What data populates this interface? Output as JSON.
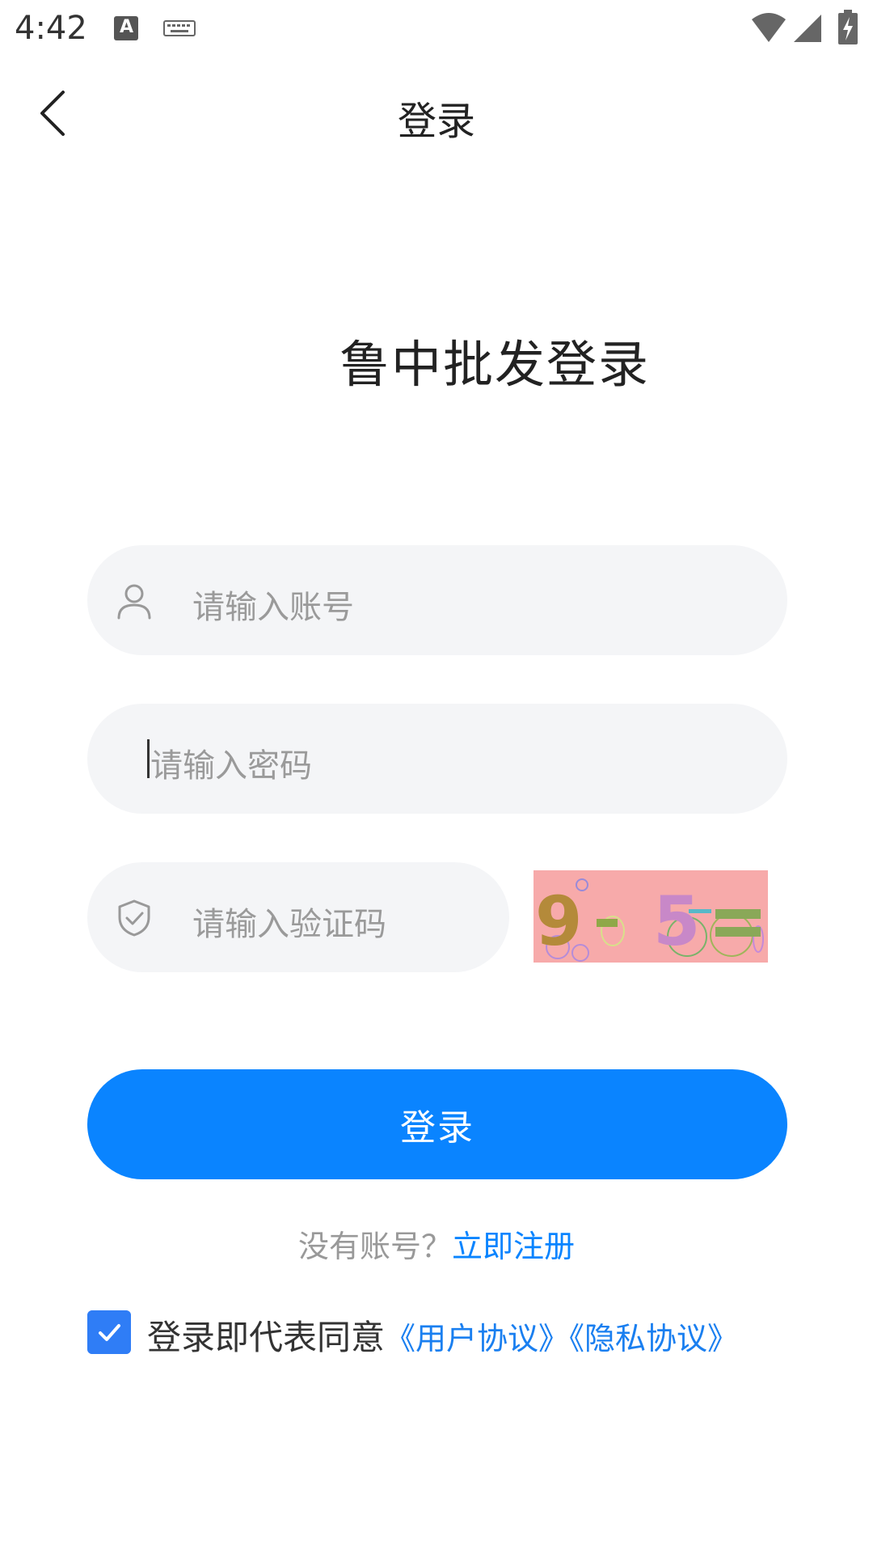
{
  "status_bar": {
    "time": "4:42",
    "icons": [
      "a-badge-icon",
      "keyboard-icon",
      "wifi-icon",
      "signal-icon",
      "battery-charging-icon"
    ]
  },
  "nav": {
    "title": "登录",
    "back_icon": "chevron-left-icon"
  },
  "headline": "鲁中批发登录",
  "form": {
    "account": {
      "placeholder": "请输入账号",
      "icon": "user-icon"
    },
    "password": {
      "placeholder": "请输入密码"
    },
    "captcha": {
      "placeholder": "请输入验证码",
      "icon": "shield-check-icon",
      "image_text": "9 - 5 ="
    }
  },
  "login_button": "登录",
  "register": {
    "prompt": "没有账号？",
    "link": "立即注册"
  },
  "agreement": {
    "checked": true,
    "text": "登录即代表同意",
    "user_agreement": "《用户协议》",
    "privacy_agreement": "《隐私协议》"
  },
  "colors": {
    "primary": "#0a84ff",
    "field_bg": "#f4f5f7",
    "captcha_bg": "#f7aaaa"
  }
}
